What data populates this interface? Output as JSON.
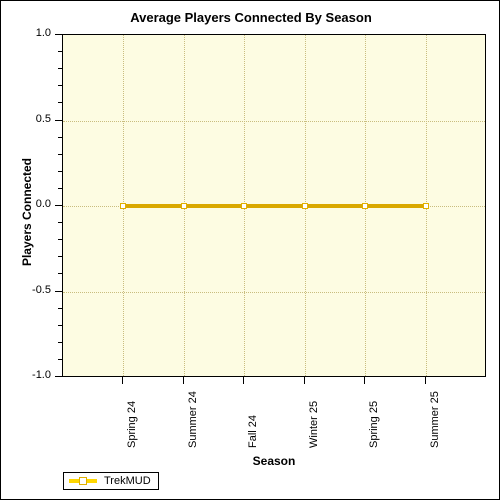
{
  "chart_data": {
    "type": "line",
    "title": "Average Players Connected By Season",
    "xlabel": "Season",
    "ylabel": "Players Connected",
    "categories": [
      "Spring 24",
      "Summer 24",
      "Fall 24",
      "Winter 25",
      "Spring 25",
      "Summer 25"
    ],
    "series": [
      {
        "name": "TrekMUD",
        "values": [
          0,
          0,
          0,
          0,
          0,
          0
        ],
        "color": "#d9a800",
        "marker": "white-square"
      }
    ],
    "ylim": [
      -1.0,
      1.0
    ],
    "y_major_ticks": [
      "1.0",
      "0.5",
      "0.0",
      "-0.5",
      "-1.0"
    ],
    "y_major_tick_values": [
      1.0,
      0.5,
      0.0,
      -0.5,
      -1.0
    ],
    "y_minor_tick_step": 0.1,
    "grid": true,
    "grid_color": "#c9bd7e",
    "plot_background": "#fdfce2",
    "legend_position": "bottom-left",
    "legend_entries": [
      "TrekMUD"
    ]
  },
  "legend": {
    "items": [
      {
        "label": "TrekMUD"
      }
    ]
  }
}
